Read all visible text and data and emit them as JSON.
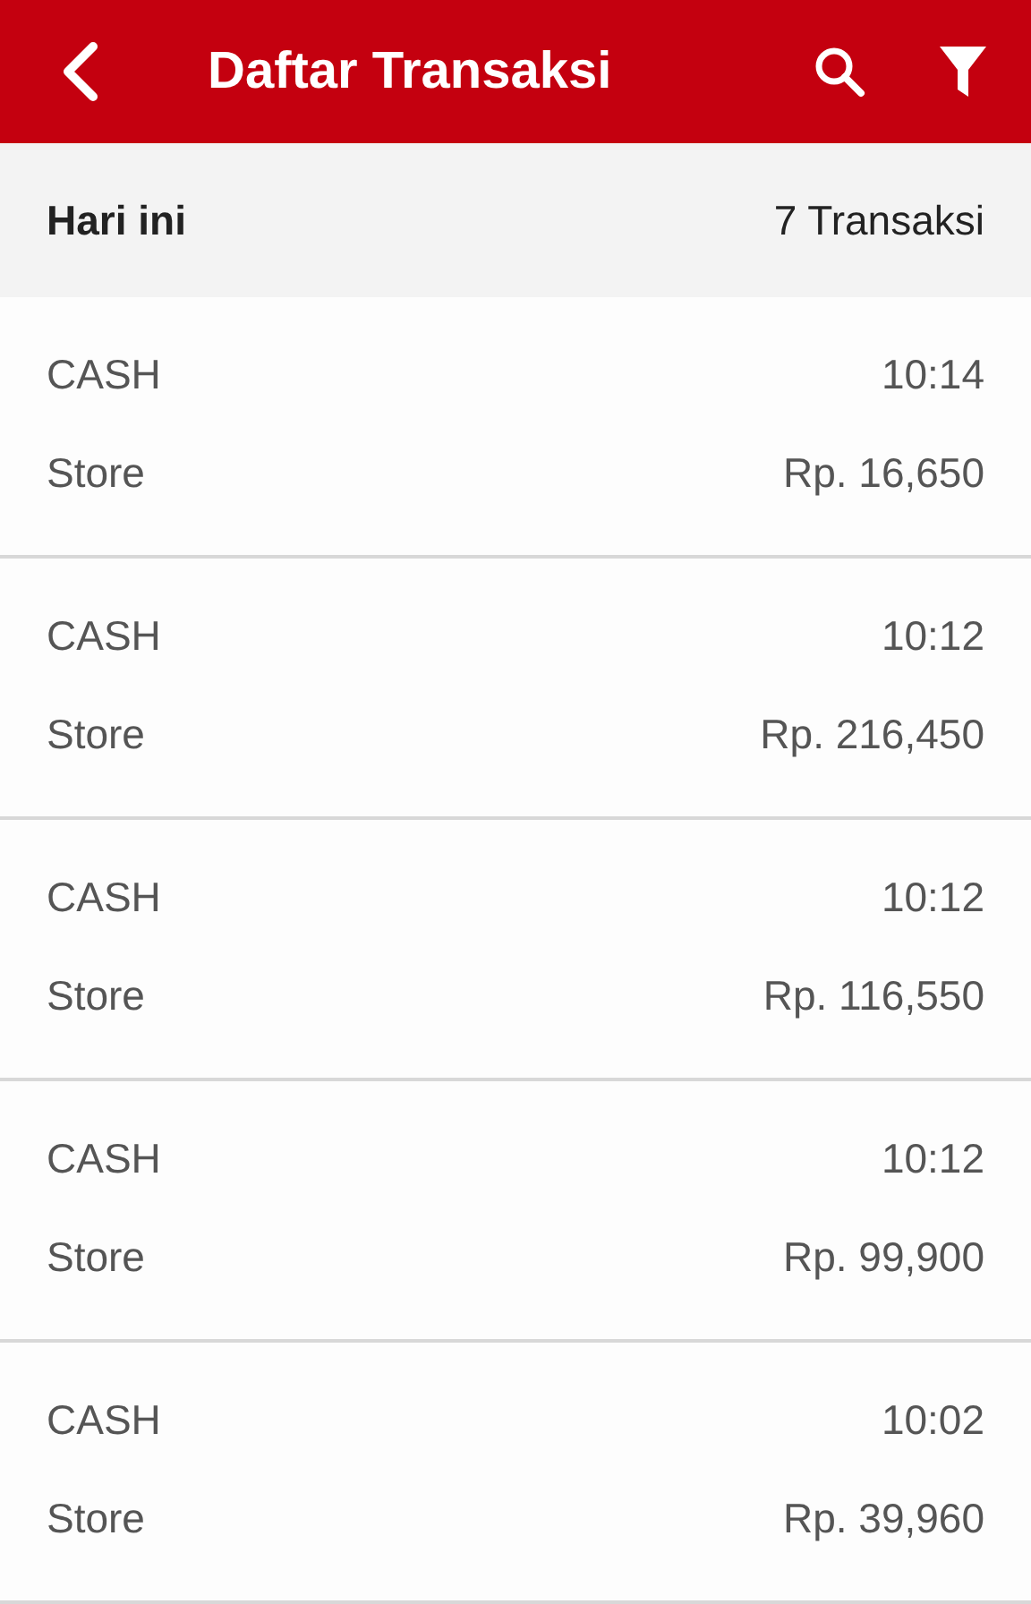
{
  "app_bar": {
    "title": "Daftar Transaksi"
  },
  "section": {
    "label": "Hari ini",
    "count": "7 Transaksi"
  },
  "transactions": [
    {
      "method": "CASH",
      "time": "10:14",
      "source": "Store",
      "amount": "Rp. 16,650"
    },
    {
      "method": "CASH",
      "time": "10:12",
      "source": "Store",
      "amount": "Rp. 216,450"
    },
    {
      "method": "CASH",
      "time": "10:12",
      "source": "Store",
      "amount": "Rp. 116,550"
    },
    {
      "method": "CASH",
      "time": "10:12",
      "source": "Store",
      "amount": "Rp. 99,900"
    },
    {
      "method": "CASH",
      "time": "10:02",
      "source": "Store",
      "amount": "Rp. 39,960"
    }
  ]
}
